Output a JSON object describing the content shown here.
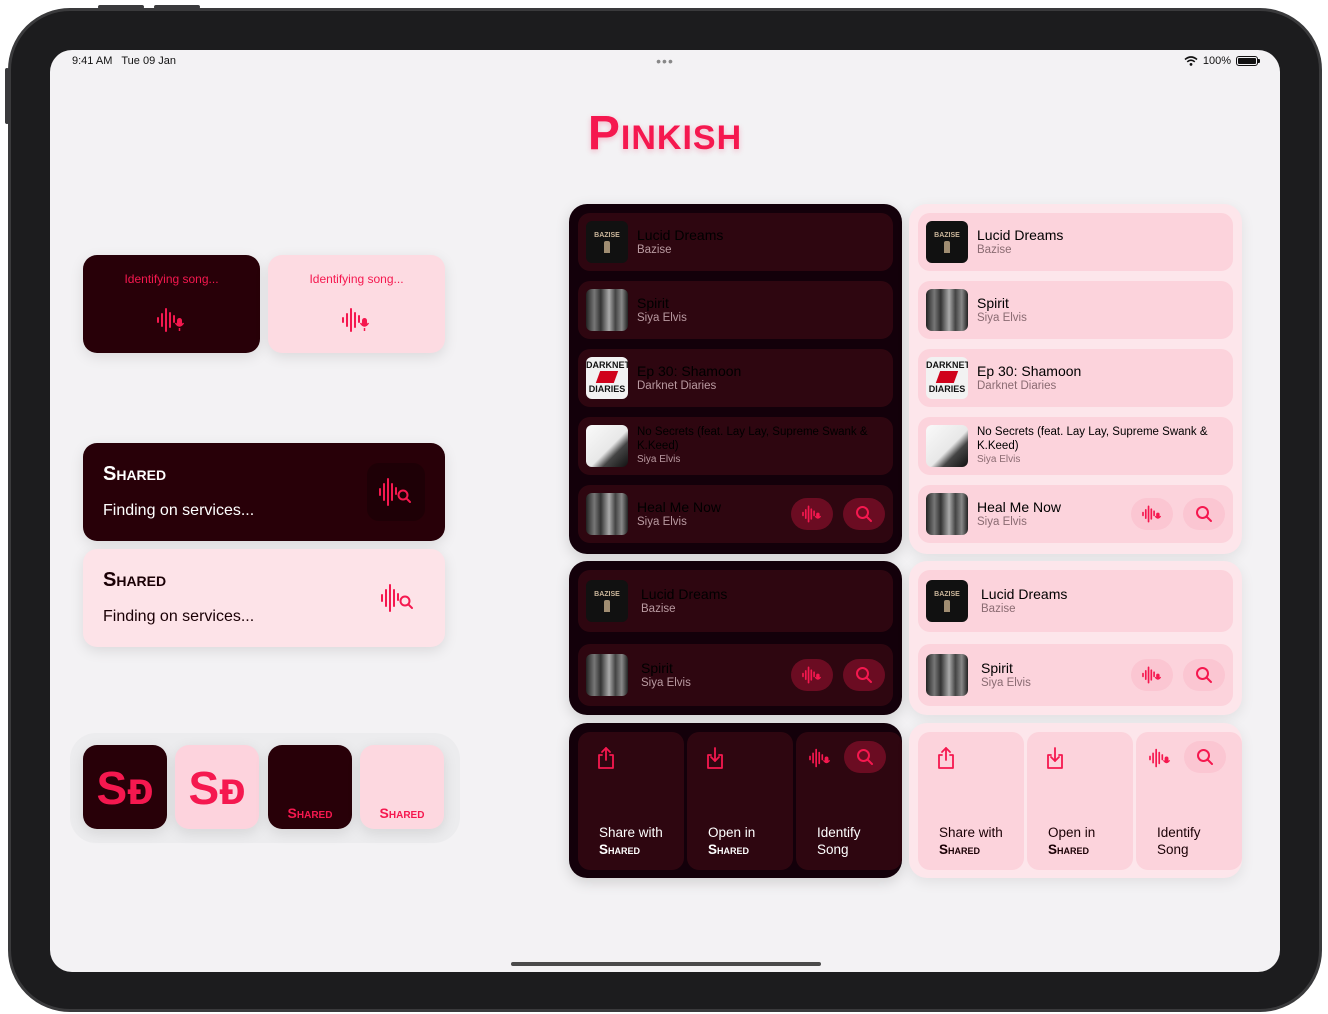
{
  "status": {
    "time": "9:41 AM",
    "date": "Tue 09 Jan",
    "battery": "100%"
  },
  "app_title": "Pinkish",
  "colors": {
    "accent": "#f5184f",
    "dark_bg": "#280008",
    "light_bg": "#fddbe2"
  },
  "identifying": {
    "dark_label": "Identifying song...",
    "light_label": "Identifying song..."
  },
  "shared_widgets": {
    "dark": {
      "title": "Shared",
      "subtitle": "Finding on services..."
    },
    "light": {
      "title": "Shared",
      "subtitle": "Finding on services..."
    }
  },
  "app_icons": {
    "monogram": "Sᴆ",
    "wordmark": "Shared"
  },
  "tracks": [
    {
      "title": "Lucid Dreams",
      "artist": "Bazise"
    },
    {
      "title": "Spirit",
      "artist": "Siya Elvis"
    },
    {
      "title": "Ep 30: Shamoon",
      "artist": "Darknet Diaries"
    },
    {
      "title": "No Secrets (feat. Lay Lay, Supreme Swank & K.Keed)",
      "artist": "Siya Elvis"
    },
    {
      "title": "Heal Me Now",
      "artist": "Siya Elvis"
    }
  ],
  "art_text": {
    "bazise": "BAZISE",
    "darknet_top": "DARKNET",
    "darknet_bottom": "DIARIES"
  },
  "actions": {
    "share_line1": "Share with",
    "share_line2": "Shared",
    "open_line1": "Open in",
    "open_line2": "Shared",
    "identify_line1": "Identify",
    "identify_line2": "Song"
  },
  "icons": [
    "waveform-mic-icon",
    "waveform-search-icon",
    "search-icon",
    "share-icon",
    "open-in-icon",
    "wifi-icon",
    "battery-icon"
  ]
}
